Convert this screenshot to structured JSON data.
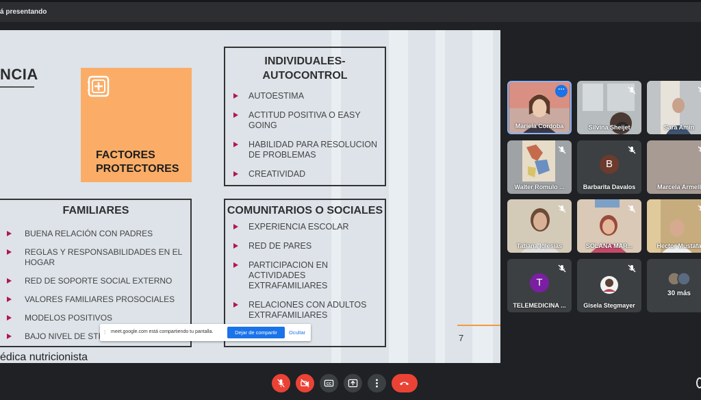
{
  "topbar": {
    "presenting_text": "á presentando"
  },
  "slide": {
    "title_fragment": "NCIA",
    "orange_box": {
      "label": "FACTORES PROTECTORES",
      "icon": "safe-plus-icon"
    },
    "individuales": {
      "heading": "INDIVIDUALES-AUTOCONTROL",
      "items": [
        "AUTOESTIMA",
        "ACTITUD POSITIVA O EASY GOING",
        "HABILIDAD PARA RESOLUCION DE  PROBLEMAS",
        "CREATIVIDAD"
      ]
    },
    "familiares": {
      "heading": "FAMILIARES",
      "items": [
        "BUENA RELACIÓN CON PADRES",
        "REGLAS Y RESPONSABILIDADES EN EL HOGAR",
        "RED DE SOPORTE SOCIAL EXTERNO",
        "VALORES FAMILIARES PROSOCIALES",
        "MODELOS POSITIVOS",
        "BAJO NIVEL DE STRESS"
      ]
    },
    "comunitarios": {
      "heading": "COMUNITARIOS O SOCIALES",
      "items": [
        "EXPERIENCIA ESCOLAR",
        "RED DE PARES",
        "PARTICIPACION EN ACTIVIDADES EXTRAFAMILIARES",
        "RELACIONES CON ADULTOS EXTRAFAMILIARES"
      ]
    },
    "page_number": "7",
    "footer": "édica nutricionista",
    "accent_color": "#b3174c",
    "orange_color": "#fbad67"
  },
  "share_banner": {
    "message": "meet.google.com está compartiendo tu pantalla.",
    "stop_label": "Dejar de compartir",
    "hide_label": "Ocultar"
  },
  "participants": [
    {
      "name": "Mariela Cordoba",
      "muted": false,
      "has_video": true,
      "active": true
    },
    {
      "name": "Silvina Sheijet",
      "muted": true,
      "has_video": true
    },
    {
      "name": "Sara Amin",
      "muted": true,
      "has_video": true
    },
    {
      "name": "Walter Romulo ...",
      "muted": true,
      "has_video": true
    },
    {
      "name": "Barbarita Davalos",
      "muted": true,
      "has_video": false,
      "initial": "B",
      "avatar_color": "#6d3a2e"
    },
    {
      "name": "Marcela Armell",
      "muted": true,
      "has_video": true
    },
    {
      "name": "Tatiana Iglesias",
      "muted": true,
      "has_video": true
    },
    {
      "name": "SOLANA MAR...",
      "muted": true,
      "has_video": true
    },
    {
      "name": "Hector Mustafa",
      "muted": true,
      "has_video": true
    },
    {
      "name": "TELEMEDICINA ...",
      "muted": true,
      "has_video": false,
      "initial": "T",
      "avatar_color": "#7b1fa2"
    },
    {
      "name": "Gisela Stegmayer",
      "muted": true,
      "has_video": false
    },
    {
      "name": "30 más",
      "muted": false,
      "has_video": false
    }
  ],
  "controls": [
    "mic-off-icon",
    "camera-off-icon",
    "captions-icon",
    "present-icon",
    "more-options-icon",
    "hang-up-icon"
  ]
}
